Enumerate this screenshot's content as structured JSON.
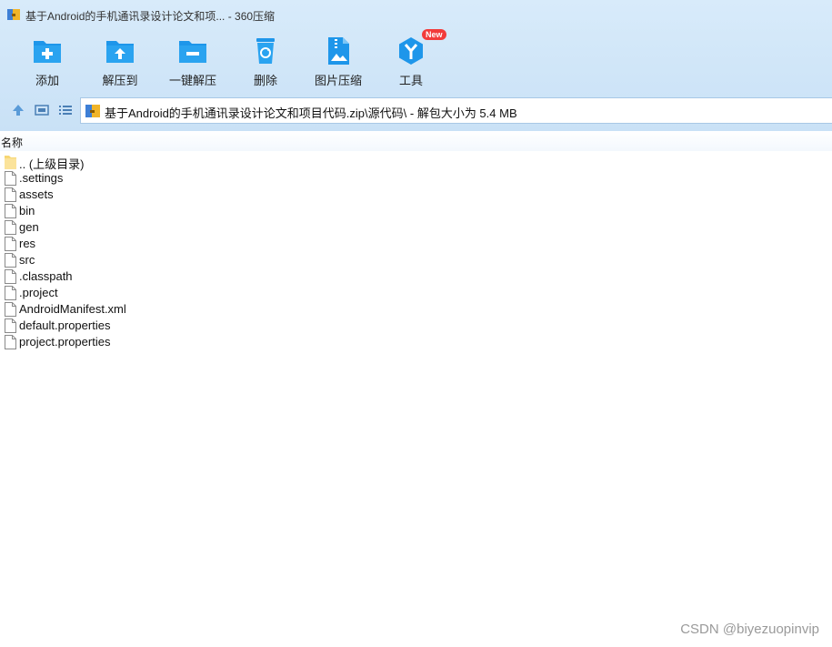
{
  "window": {
    "title": "基于Android的手机通讯录设计论文和项... - 360压缩",
    "app_icon": "archive-icon"
  },
  "toolbar": {
    "add": "添加",
    "extract_to": "解压到",
    "one_click_extract": "一键解压",
    "delete": "删除",
    "image_compress": "图片压缩",
    "tools": "工具",
    "tools_badge": "New"
  },
  "nav": {
    "up_icon": "arrow-up-icon",
    "view_icon": "thumbnail-view-icon",
    "list_icon": "list-view-icon",
    "path": "基于Android的手机通讯录设计论文和项目代码.zip\\源代码\\ - 解包大小为 5.4 MB"
  },
  "list": {
    "column_name": "名称",
    "items": [
      {
        "name": ".. (上级目录)",
        "type": "folder"
      },
      {
        "name": ".settings",
        "type": "file"
      },
      {
        "name": "assets",
        "type": "file"
      },
      {
        "name": "bin",
        "type": "file"
      },
      {
        "name": "gen",
        "type": "file"
      },
      {
        "name": "res",
        "type": "file"
      },
      {
        "name": "src",
        "type": "file"
      },
      {
        "name": ".classpath",
        "type": "file"
      },
      {
        "name": ".project",
        "type": "file"
      },
      {
        "name": "AndroidManifest.xml",
        "type": "file"
      },
      {
        "name": "default.properties",
        "type": "file"
      },
      {
        "name": "project.properties",
        "type": "file"
      }
    ]
  },
  "watermark": "CSDN @biyezuopinvip",
  "colors": {
    "accent": "#1e96ea",
    "chrome_bg": "#d3e8f9",
    "badge": "#f23b3b"
  }
}
